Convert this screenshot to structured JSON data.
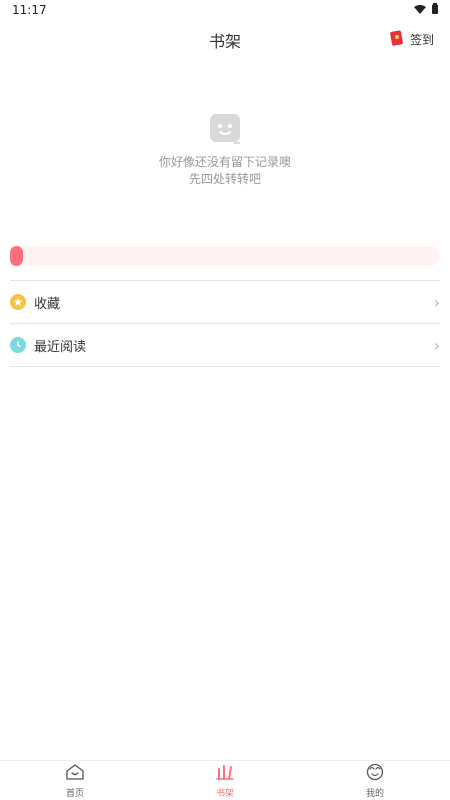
{
  "status": {
    "time": "11:17"
  },
  "header": {
    "title": "书架",
    "checkin_label": "签到"
  },
  "empty_state": {
    "line1": "你好像还没有留下记录噢",
    "line2": "先四处转转吧"
  },
  "progress": {
    "value": 0.03
  },
  "list": {
    "items": [
      {
        "label": "收藏",
        "icon": "star-icon",
        "icon_color": "#f6c343"
      },
      {
        "label": "最近阅读",
        "icon": "clock-icon",
        "icon_color": "#7dd9e0"
      }
    ]
  },
  "bottom_nav": {
    "tabs": [
      {
        "label": "首页",
        "icon": "home-icon"
      },
      {
        "label": "书架",
        "icon": "bookshelf-icon"
      },
      {
        "label": "我的",
        "icon": "user-icon"
      }
    ]
  },
  "colors": {
    "accent": "#ff6f7a",
    "progress_track": "#fff4f4"
  }
}
